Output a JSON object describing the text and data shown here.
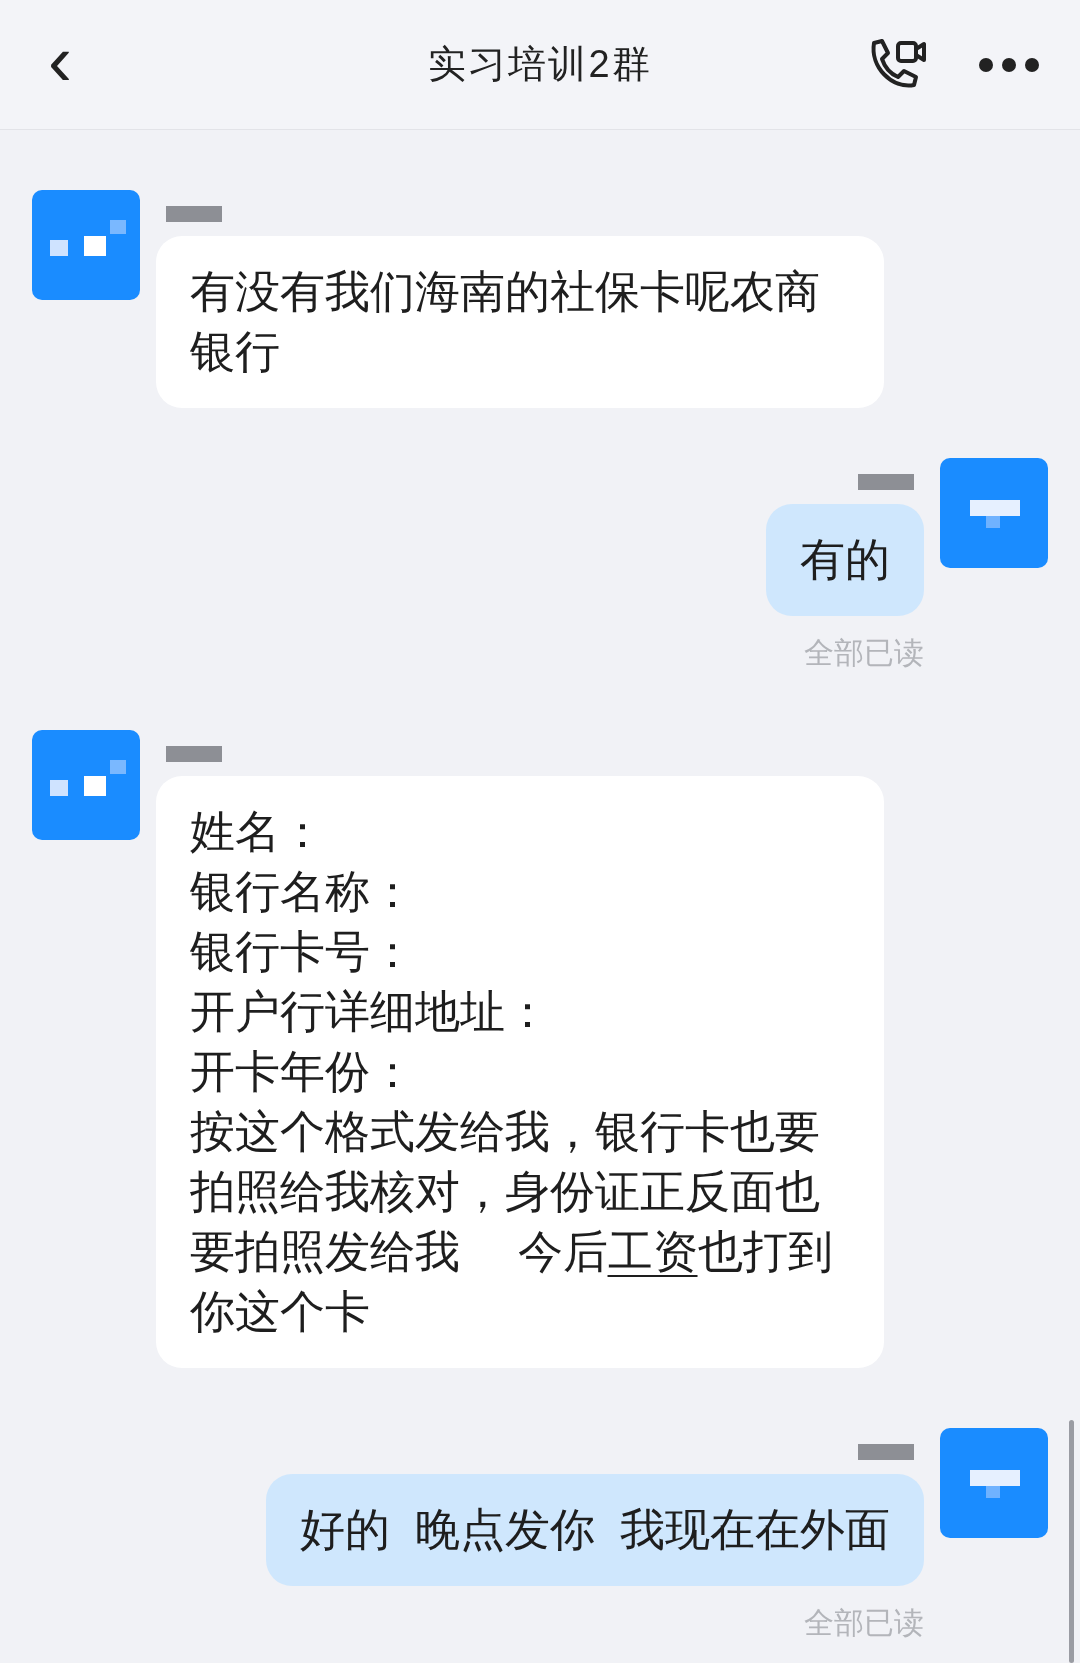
{
  "header": {
    "back_icon": "‹",
    "title": "实习培训2群"
  },
  "messages": [
    {
      "outgoing": false,
      "lines": [
        {
          "parts": [
            {
              "text": "有没有我们海南的社保卡呢农商银行"
            }
          ]
        }
      ]
    },
    {
      "outgoing": true,
      "lines": [
        {
          "parts": [
            {
              "text": "有的"
            }
          ]
        }
      ],
      "receipt": "全部已读"
    },
    {
      "outgoing": false,
      "lines": [
        {
          "parts": [
            {
              "text": "姓名："
            }
          ]
        },
        {
          "parts": [
            {
              "text": "银行名称："
            }
          ]
        },
        {
          "parts": [
            {
              "text": "银行卡号："
            }
          ]
        },
        {
          "parts": [
            {
              "text": "开户行详细地址："
            }
          ]
        },
        {
          "parts": [
            {
              "text": "开卡年份："
            }
          ]
        },
        {
          "parts": [
            {
              "text": "按这个格式发给我，银行卡也要拍照给我核对，身份证正反面也要拍照发给我　 今后"
            },
            {
              "text": "工资",
              "underline": true
            },
            {
              "text": "也打到你这个卡"
            }
          ]
        }
      ]
    },
    {
      "outgoing": true,
      "lines": [
        {
          "parts": [
            {
              "text": "好的  晚点发你  我现在在外面"
            }
          ]
        }
      ],
      "receipt": "全部已读"
    }
  ]
}
